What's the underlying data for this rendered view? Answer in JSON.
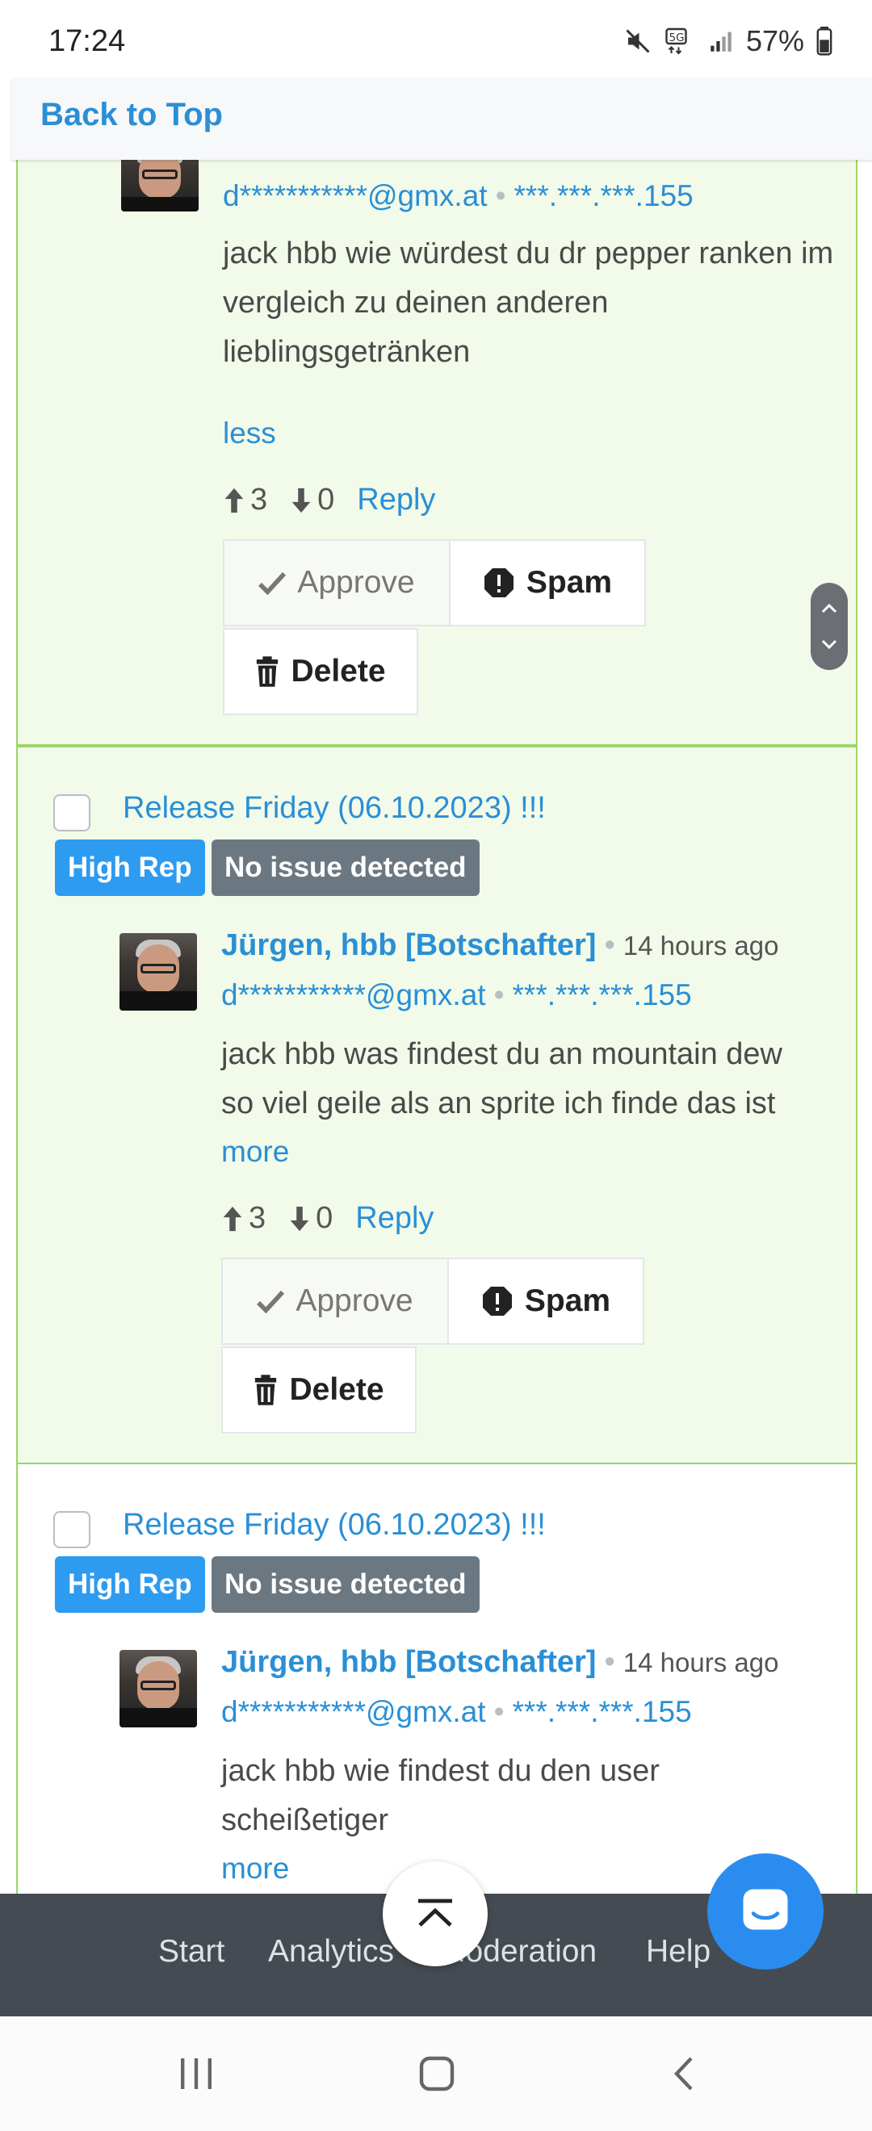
{
  "status_bar": {
    "time": "17:24",
    "battery": "57%",
    "network": "5G"
  },
  "header": {
    "back_to_top": "Back to Top"
  },
  "card1": {
    "meta_email": "d***********@gmx.at",
    "meta_ip": "***.***.***.155",
    "body": "jack hbb wie würdest du dr pepper ranken im vergleich zu deinen anderen lieblingsgetränken",
    "toggle": "less",
    "upvotes": "3",
    "downvotes": "0",
    "reply": "Reply",
    "approve": "Approve",
    "spam": "Spam",
    "delete": "Delete"
  },
  "card2": {
    "title": "Release Friday (06.10.2023) !!!",
    "badge_rep": "High Rep",
    "badge_issue": "No issue detected",
    "author": "Jürgen, hbb [Botschafter]",
    "time": "14 hours ago",
    "meta_email": "d***********@gmx.at",
    "meta_ip": "***.***.***.155",
    "body_line1": "jack hbb was findest du an mountain dew",
    "body_line2": "so viel geile als an sprite ich finde das ist",
    "toggle": "more",
    "upvotes": "3",
    "downvotes": "0",
    "reply": "Reply",
    "approve": "Approve",
    "spam": "Spam",
    "delete": "Delete"
  },
  "card3": {
    "title": "Release Friday (06.10.2023) !!!",
    "badge_rep": "High Rep",
    "badge_issue": "No issue detected",
    "author": "Jürgen, hbb [Botschafter]",
    "time": "14 hours ago",
    "meta_email": "d***********@gmx.at",
    "meta_ip": "***.***.***.155",
    "body_line1": "jack hbb wie findest du den user",
    "body_line2": "scheißetiger",
    "toggle": "more"
  },
  "bottom_nav": {
    "items": [
      "Start",
      "Analytics",
      "Moderation",
      "Help"
    ]
  },
  "colors": {
    "accent": "#2a8fd6",
    "card_bg": "#f2fbe9",
    "card_border": "#9bd66a",
    "badge_rep": "#2d9bf0",
    "badge_issue": "#6c7881",
    "nav_bg": "#454b52",
    "chat": "#2b8cf0"
  }
}
